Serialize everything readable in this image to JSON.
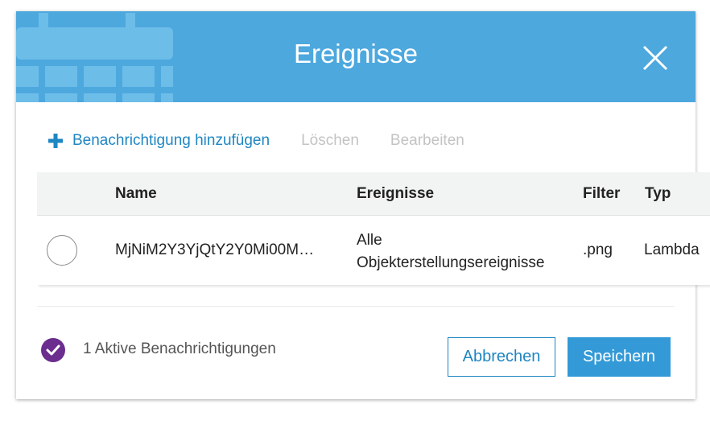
{
  "dialog": {
    "title": "Ereignisse",
    "close_icon": "close-icon",
    "header_art_icon": "calendar-icon"
  },
  "toolbar": {
    "add_icon": "plus-icon",
    "add_label": "Benachrichtigung hinzufügen",
    "delete_label": "Löschen",
    "edit_label": "Bearbeiten"
  },
  "table": {
    "columns": {
      "name": "Name",
      "events": "Ereignisse",
      "filter": "Filter",
      "type": "Typ"
    },
    "rows": [
      {
        "name": "MjNiM2Y3YjQtY2Y0Mi00M…",
        "events_line1": "Alle",
        "events_line2": "Objekterstellungsereignisse",
        "filter": ".png",
        "type": "Lambda",
        "selected": false
      }
    ]
  },
  "footer": {
    "status_icon": "check-circle-icon",
    "status_text": "1 Aktive Benachrichtigungen",
    "cancel_label": "Abbrechen",
    "save_label": "Speichern"
  },
  "colors": {
    "header": "#4da8de",
    "link": "#1e86c2",
    "primary_button": "#339ad7",
    "check_badge": "#6b2d8e",
    "disabled_text": "#c3c3c3"
  }
}
